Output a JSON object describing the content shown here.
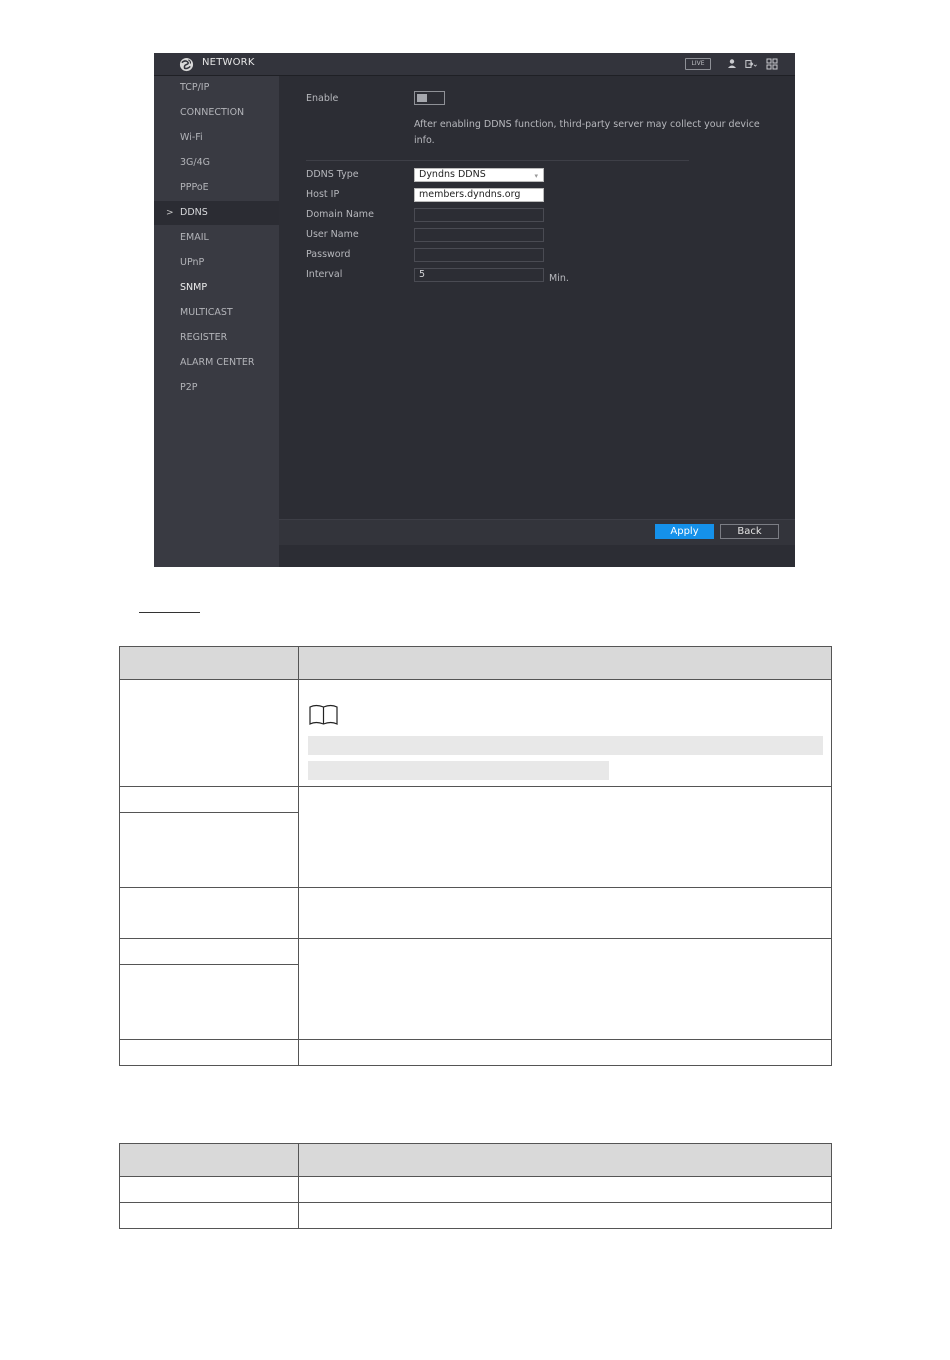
{
  "window": {
    "title": "NETWORK",
    "live_badge": "LIVE"
  },
  "sidebar": {
    "items": [
      {
        "label": "TCP/IP"
      },
      {
        "label": "CONNECTION"
      },
      {
        "label": "Wi-Fi"
      },
      {
        "label": "3G/4G"
      },
      {
        "label": "PPPoE"
      },
      {
        "label": "DDNS",
        "active": true
      },
      {
        "label": "EMAIL"
      },
      {
        "label": "UPnP"
      },
      {
        "label": "SNMP"
      },
      {
        "label": "MULTICAST"
      },
      {
        "label": "REGISTER"
      },
      {
        "label": "ALARM CENTER"
      },
      {
        "label": "P2P"
      }
    ],
    "active_marker": ">"
  },
  "ddns": {
    "enable_label": "Enable",
    "enable_on": false,
    "info_text": "After enabling DDNS function, third-party server may collect your device info.",
    "ddns_type_label": "DDNS Type",
    "ddns_type_value": "Dyndns DDNS",
    "host_ip_label": "Host IP",
    "host_ip_value": "members.dyndns.org",
    "domain_name_label": "Domain Name",
    "domain_name_value": "",
    "user_name_label": "User Name",
    "user_name_value": "",
    "password_label": "Password",
    "password_value": "",
    "interval_label": "Interval",
    "interval_value": "5",
    "interval_unit": "Min."
  },
  "footer": {
    "apply_label": "Apply",
    "back_label": "Back"
  },
  "colors": {
    "panel_bg": "#2c2d34",
    "sidebar_bg": "#393a42",
    "accent": "#1591ea"
  },
  "icons": [
    "globe-logo-icon",
    "user-icon",
    "logout-icon",
    "grid-icon",
    "book-note-icon",
    "dropdown-caret-icon"
  ]
}
